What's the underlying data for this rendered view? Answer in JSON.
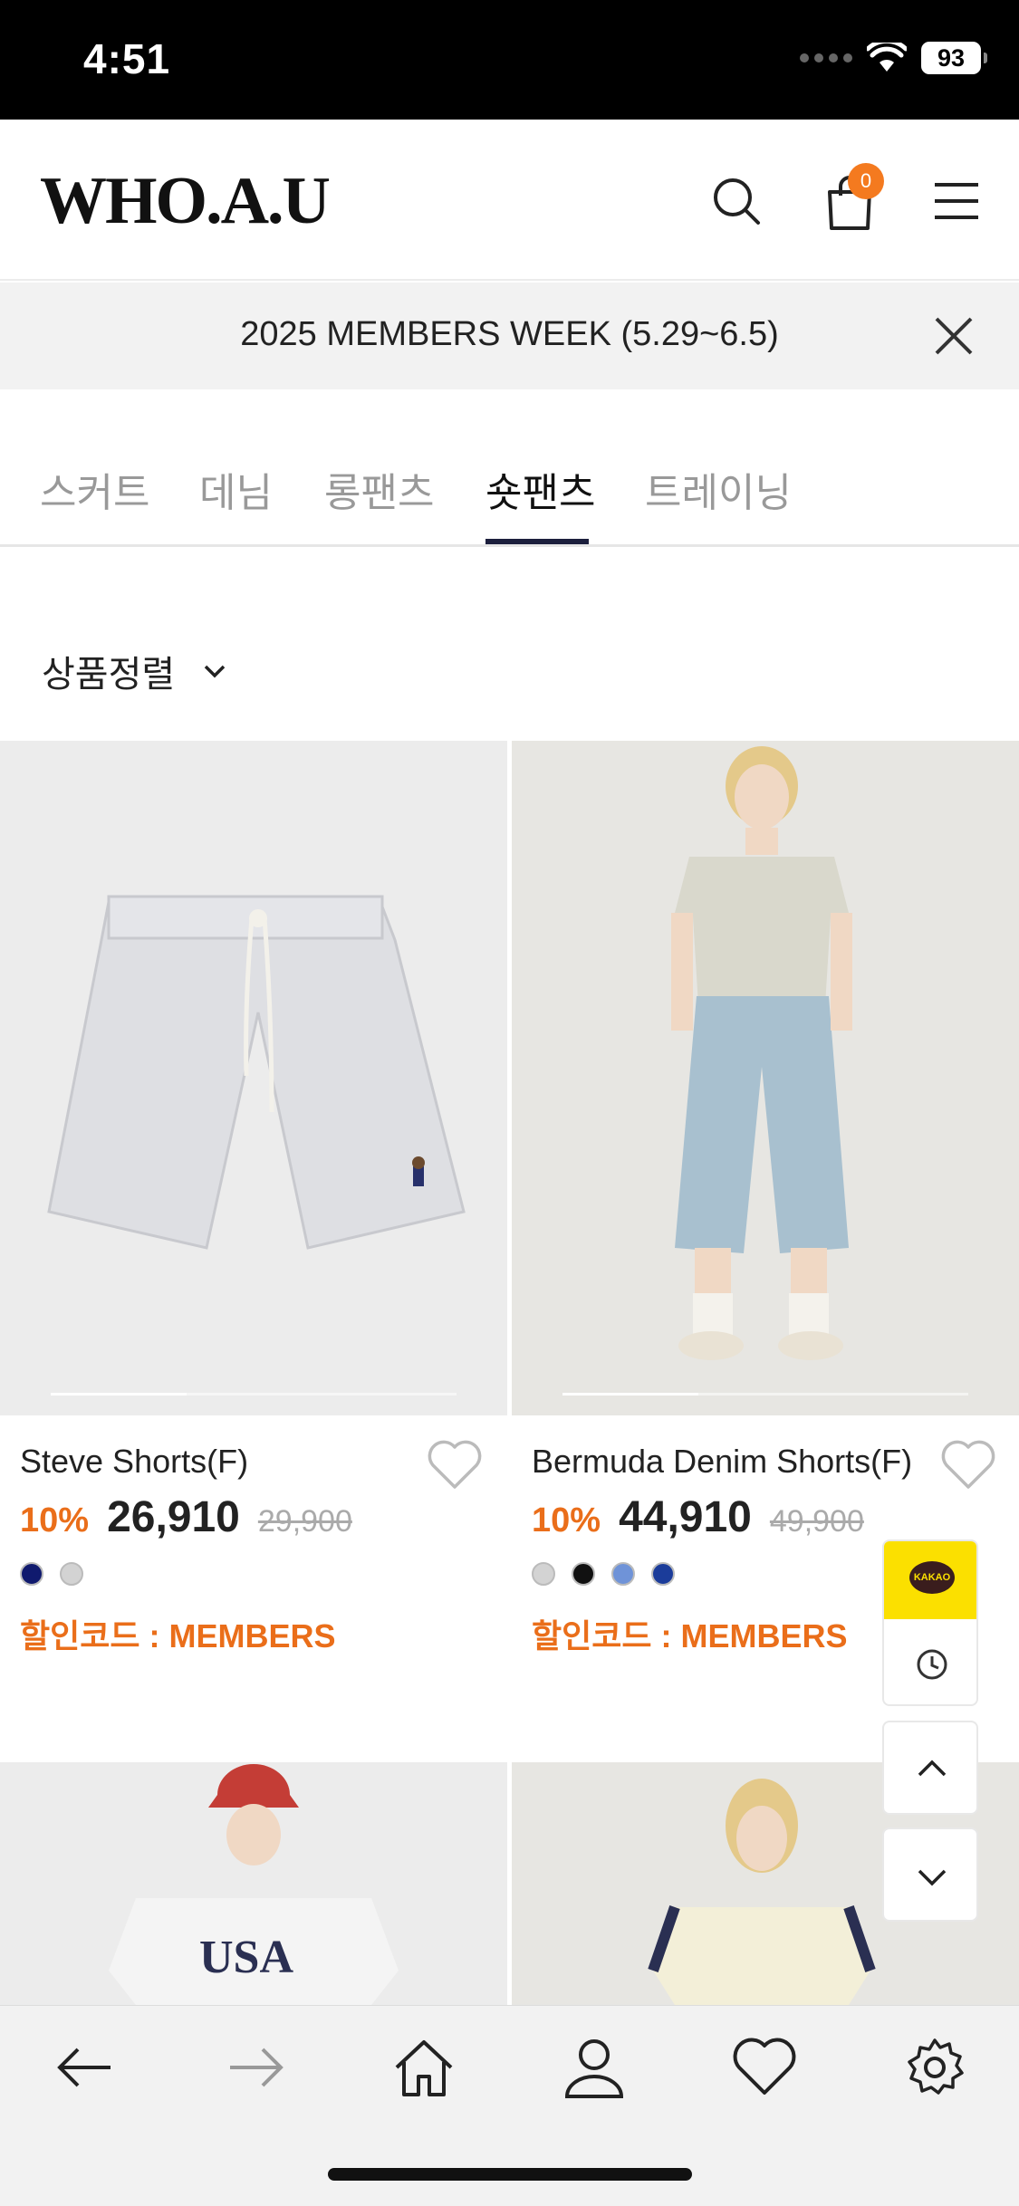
{
  "status_bar": {
    "time": "4:51",
    "battery": "93"
  },
  "header": {
    "logo": "WHO.A.U",
    "cart_count": "0"
  },
  "banner": {
    "text": "2025 MEMBERS WEEK (5.29~6.5)"
  },
  "tabs": [
    {
      "label": "스커트",
      "active": false
    },
    {
      "label": "데님",
      "active": false
    },
    {
      "label": "롱팬츠",
      "active": false
    },
    {
      "label": "숏팬츠",
      "active": true
    },
    {
      "label": "트레이닝",
      "active": false
    }
  ],
  "sort": {
    "label": "상품정렬"
  },
  "products": [
    {
      "name": "Steve Shorts(F)",
      "discount": "10%",
      "price": "26,910",
      "original_price": "29,900",
      "colors": [
        "#101a6e",
        "#d3d3d3"
      ],
      "promo": "할인코드 : MEMBERS"
    },
    {
      "name": "Bermuda Denim Shorts(F)",
      "discount": "10%",
      "price": "44,910",
      "original_price": "49,900",
      "colors": [
        "#d3d3d3",
        "#111111",
        "#6f93d8",
        "#1b3c9a"
      ],
      "promo": "할인코드 : MEMBERS"
    }
  ],
  "floating": {
    "kakao_label": "KAKAO"
  },
  "colors": {
    "accent": "#ea6e1a",
    "tab_active": "#1c1f3d",
    "kakao": "#fbe000"
  }
}
